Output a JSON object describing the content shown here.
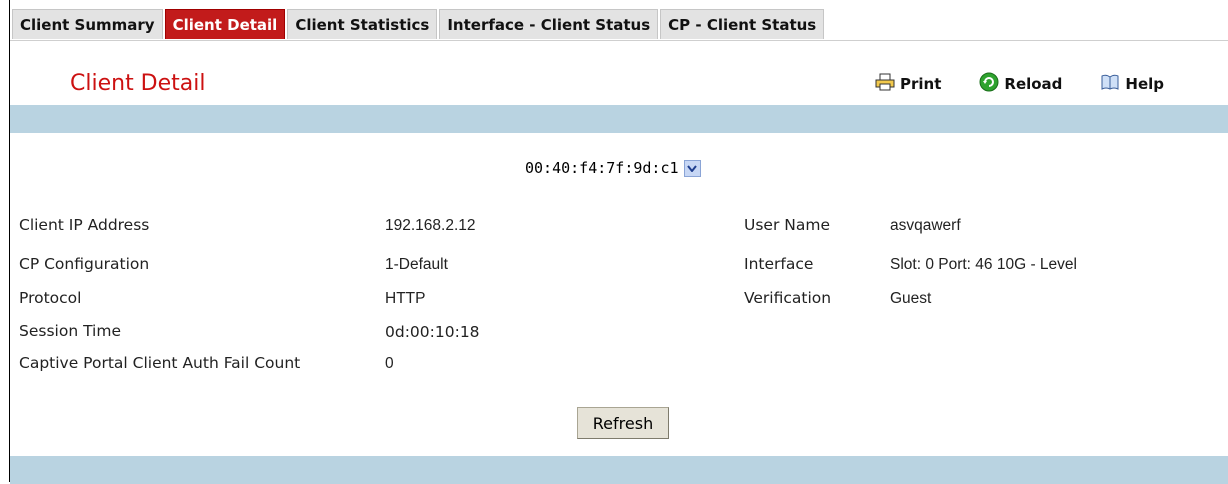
{
  "tabs": [
    {
      "label": "Client Summary",
      "active": false
    },
    {
      "label": "Client Detail",
      "active": true
    },
    {
      "label": "Client Statistics",
      "active": false
    },
    {
      "label": "Interface - Client Status",
      "active": false
    },
    {
      "label": "CP - Client Status",
      "active": false
    }
  ],
  "header": {
    "title": "Client Detail",
    "print_label": "Print",
    "reload_label": "Reload",
    "help_label": "Help"
  },
  "client_select": {
    "selected": "00:40:f4:7f:9d:c1"
  },
  "details_left": [
    {
      "label": "Client IP Address",
      "value": "192.168.2.12"
    },
    {
      "label": "CP Configuration",
      "value": "1-Default"
    },
    {
      "label": "Protocol",
      "value": "HTTP"
    },
    {
      "label": "Session Time",
      "value": "0d:00:10:18"
    },
    {
      "label": "Captive Portal Client Auth Fail Count",
      "value": "0"
    }
  ],
  "details_right": [
    {
      "label": "User Name",
      "value": "asvqawerf"
    },
    {
      "label": "Interface",
      "value": "Slot: 0 Port: 46 10G - Level"
    },
    {
      "label": "Verification",
      "value": "Guest"
    }
  ],
  "actions": {
    "refresh_label": "Refresh"
  },
  "colors": {
    "active_tab": "#c21b1b",
    "title": "#cc1111",
    "band": "#b9d3e1"
  }
}
